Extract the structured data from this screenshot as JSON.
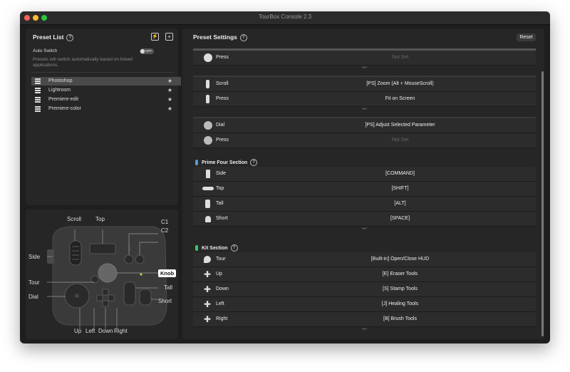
{
  "window": {
    "title": "TourBox Console 2.3"
  },
  "colors": {
    "close": "#fe5f57",
    "minimize": "#febc2e",
    "zoom": "#28c840",
    "prime_accent": "#5b9bd5",
    "kit_accent": "#3ec46d",
    "selected": "#4a4a4a"
  },
  "preset_list": {
    "title": "Preset List",
    "auto_switch": {
      "label": "Auto Switch",
      "toggle": "OFF",
      "description": "Presets will switch automatically based on linked applications."
    },
    "items": [
      {
        "label": "Photoshop",
        "selected": true
      },
      {
        "label": "Lightroom",
        "selected": false
      },
      {
        "label": "Premiere-edit",
        "selected": false
      },
      {
        "label": "Premiere-color",
        "selected": false
      }
    ]
  },
  "device_labels": {
    "scroll": "Scroll",
    "top": "Top",
    "c1": "C1",
    "c2": "C2",
    "side": "Side",
    "knob": "Knob",
    "tour": "Tour",
    "tall": "Tall",
    "dial": "Dial",
    "short": "Short",
    "up": "Up",
    "left": "Left",
    "down": "Down",
    "right": "Right"
  },
  "preset_settings": {
    "title": "Preset Settings",
    "reset": "Reset",
    "group1": [
      {
        "name": "Press",
        "value": "Not Set",
        "icon": "knob-icon"
      }
    ],
    "group2": [
      {
        "name": "Scroll",
        "value": "[PS] Zoom (Alt + MouseScroll)",
        "icon": "scroll-icon"
      },
      {
        "name": "Press",
        "value": "Fit on Screen",
        "icon": "scroll-press-icon"
      }
    ],
    "group3": [
      {
        "name": "Dial",
        "value": "[PS] Adjust Selected Parameter",
        "icon": "dial-icon"
      },
      {
        "name": "Press",
        "value": "Not Set",
        "icon": "dial-press-icon"
      }
    ],
    "prime_four": {
      "title": "Prime Four Section",
      "rows": [
        {
          "name": "Side",
          "value": "[COMMAND]",
          "icon": "side-icon"
        },
        {
          "name": "Top",
          "value": "[SHIFT]",
          "icon": "top-icon"
        },
        {
          "name": "Tall",
          "value": "[ALT]",
          "icon": "tall-icon"
        },
        {
          "name": "Short",
          "value": "[SPACE]",
          "icon": "short-icon"
        }
      ]
    },
    "kit": {
      "title": "Kit Section",
      "rows": [
        {
          "name": "Tour",
          "value": "[Built-in] Open/Close HUD",
          "icon": "tour-icon"
        },
        {
          "name": "Up",
          "value": "[E] Eraser Tools",
          "icon": "dpad-up-icon"
        },
        {
          "name": "Down",
          "value": "[S] Stamp Tools",
          "icon": "dpad-down-icon"
        },
        {
          "name": "Left",
          "value": "[J] Healing Tools",
          "icon": "dpad-left-icon"
        },
        {
          "name": "Right",
          "value": "[B] Brush Tools",
          "icon": "dpad-right-icon"
        }
      ]
    }
  }
}
